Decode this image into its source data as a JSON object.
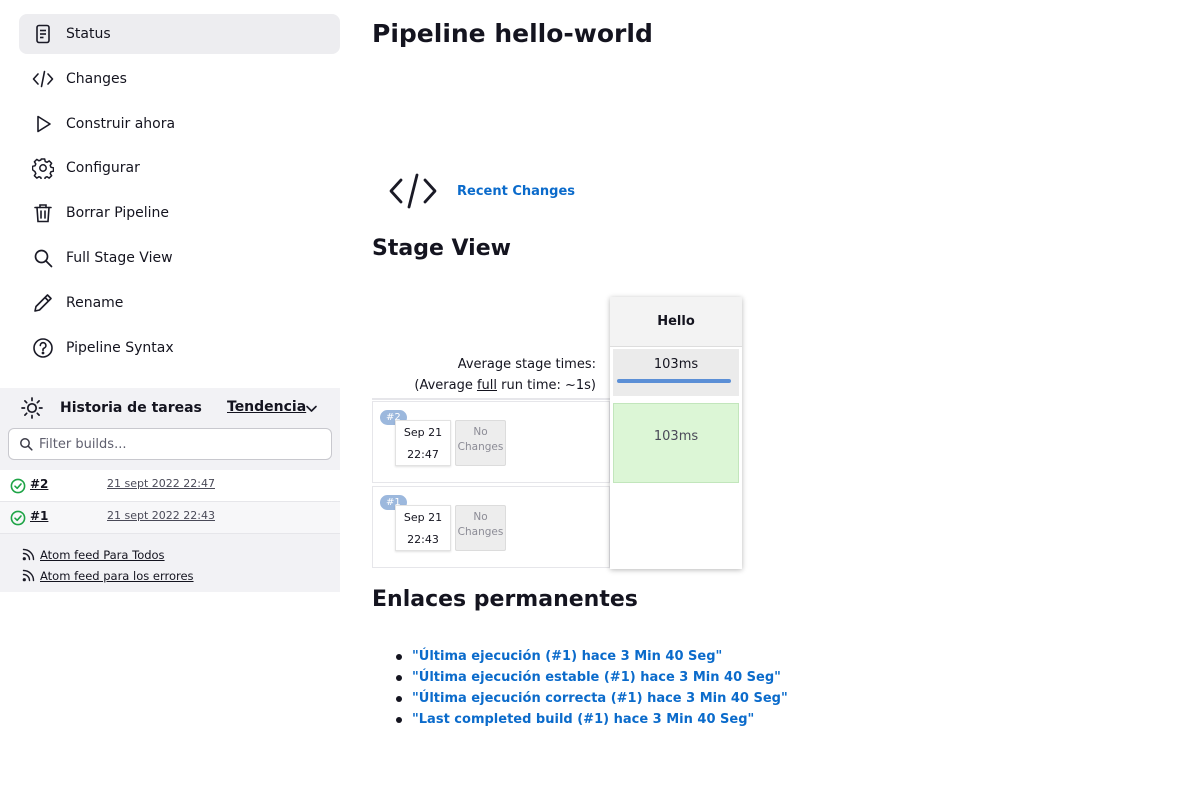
{
  "sidebar": {
    "items": [
      {
        "label": "Status",
        "icon": "status-icon",
        "active": true
      },
      {
        "label": "Changes",
        "icon": "code-icon"
      },
      {
        "label": "Construir ahora",
        "icon": "play-icon"
      },
      {
        "label": "Configurar",
        "icon": "gear-icon"
      },
      {
        "label": "Borrar Pipeline",
        "icon": "trash-icon"
      },
      {
        "label": "Full Stage View",
        "icon": "search-icon"
      },
      {
        "label": "Rename",
        "icon": "pencil-icon"
      },
      {
        "label": "Pipeline Syntax",
        "icon": "help-icon"
      }
    ]
  },
  "history": {
    "title": "Historia de tareas",
    "trend_label": "Tendencia",
    "filter_placeholder": "Filter builds...",
    "builds": [
      {
        "number": "#2",
        "date": "21 sept 2022 22:47",
        "status": "success"
      },
      {
        "number": "#1",
        "date": "21 sept 2022 22:43",
        "status": "success"
      }
    ],
    "feeds": [
      "Atom feed Para Todos",
      "Atom feed para los errores"
    ]
  },
  "main": {
    "title": "Pipeline hello-world",
    "recent_changes": "Recent Changes",
    "stage_view_title": "Stage View",
    "avg_stage_times": "Average stage times:",
    "avg_full_prefix": "(Average ",
    "avg_full_word": "full",
    "avg_full_suffix": " run time: ~1s)",
    "stage": {
      "name": "Hello",
      "avg": "103ms",
      "avg_fill": 1.0
    },
    "runs": [
      {
        "badge": "#2",
        "date": "Sep 21",
        "time": "22:47",
        "changes_line1": "No",
        "changes_line2": "Changes",
        "stage_time": "103ms",
        "status_color": "#dcf6d6"
      },
      {
        "badge": "#1",
        "date": "Sep 21",
        "time": "22:43",
        "changes_line1": "No",
        "changes_line2": "Changes",
        "stage_time": ""
      }
    ],
    "permalinks_title": "Enlaces permanentes",
    "permalinks": [
      "\"Última ejecución (#1) hace 3 Min 40 Seg\"",
      "\"Última ejecución estable (#1) hace 3 Min 40 Seg\"",
      "\"Última ejecución correcta (#1) hace 3 Min 40 Seg\"",
      "\"Last completed build (#1) hace 3 Min 40 Seg\""
    ]
  },
  "colors": {
    "link": "#0b6bcb",
    "success_bg": "#dcf6d6",
    "badge": "#9cb8dd",
    "sidebar_active": "#ededf0"
  }
}
